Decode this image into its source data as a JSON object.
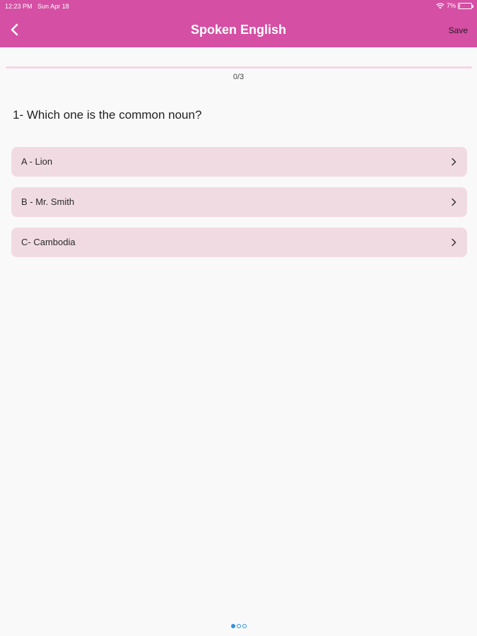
{
  "status_bar": {
    "time": "12:23 PM",
    "date": "Sun Apr 18",
    "battery": "7%",
    "battery_level": 0.07,
    "icons": [
      "wifi-icon",
      "battery-icon"
    ]
  },
  "nav": {
    "back_icon": "chevron-left-icon",
    "title": "Spoken English",
    "save_label": "Save"
  },
  "progress": {
    "label": "0/3",
    "current": 0,
    "total": 3
  },
  "question": {
    "text": "1- Which one is the common noun?"
  },
  "answers": [
    {
      "label": "A - Lion"
    },
    {
      "label": "B - Mr. Smith"
    },
    {
      "label": "C- Cambodia"
    }
  ],
  "pager": {
    "pages": 3,
    "active": 0
  },
  "colors": {
    "header": "#d54fa4",
    "answer_bg": "#f1dbe3",
    "progress_track": "#f5d6e6",
    "page_dot": "#2e8fe0"
  }
}
